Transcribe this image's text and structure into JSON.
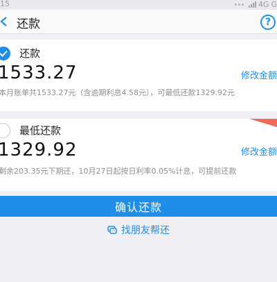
{
  "status_bar": {
    "time": "15",
    "network": "4G",
    "carrier_letter": "G"
  },
  "nav": {
    "title": "还款",
    "back_icon": "chevron-left-icon",
    "help_icon": "question-circle-icon",
    "help_glyph": "?"
  },
  "options": [
    {
      "label": "还款",
      "selected": true,
      "amount": "1533.27",
      "modify_label": "修改金额",
      "description": "本月账单共1533.27元（含逾期利息4.58元），可最低还款1329.92元"
    },
    {
      "label": "最低还款",
      "selected": false,
      "amount": "1329.92",
      "modify_label": "修改金额",
      "description": "剩余203.35元下期还，10月27日起按日利率0.05%计息，可提前还款"
    }
  ],
  "confirm_button_label": "确认还款",
  "friend_help_label": "找朋友帮还",
  "colors": {
    "accent": "#1e8ee9",
    "background": "#efeff4",
    "corner_tag": "#f06b5a"
  }
}
